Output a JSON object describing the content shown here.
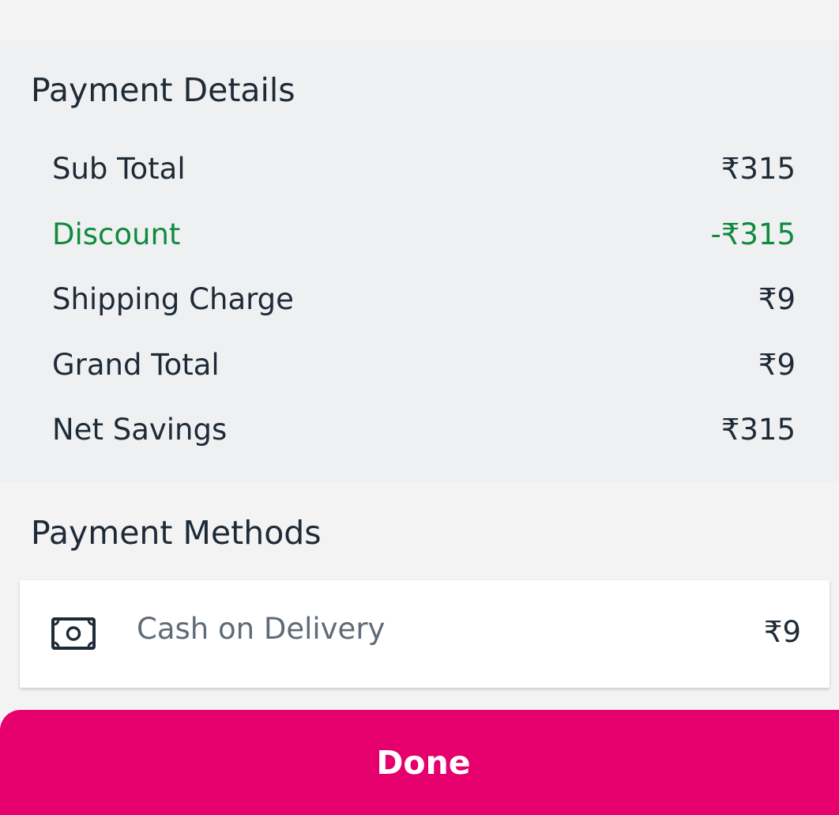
{
  "payment_details": {
    "title": "Payment Details",
    "rows": [
      {
        "label": "Sub Total",
        "value": "₹315"
      },
      {
        "label": "Discount",
        "value": "-₹315"
      },
      {
        "label": "Shipping Charge",
        "value": "₹9"
      },
      {
        "label": "Grand Total",
        "value": "₹9"
      },
      {
        "label": "Net Savings",
        "value": "₹315"
      }
    ]
  },
  "payment_methods": {
    "title": "Payment Methods",
    "items": [
      {
        "icon": "cash-icon",
        "label": "Cash on Delivery",
        "amount": "₹9"
      }
    ]
  },
  "done_button": {
    "label": "Done"
  },
  "colors": {
    "accent": "#e6006e",
    "discount": "#118a3f",
    "text": "#1e2a36",
    "muted_text": "#5f6b77"
  }
}
